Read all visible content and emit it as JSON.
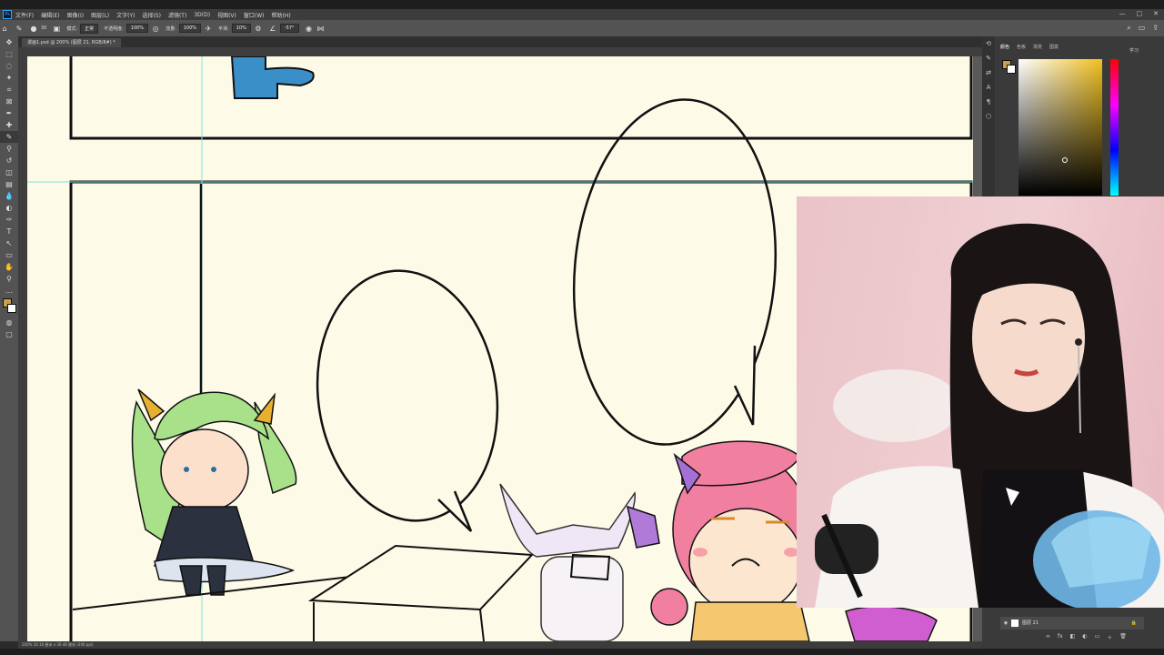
{
  "menu": {
    "app_icon": "Ps",
    "items": [
      "文件(F)",
      "编辑(E)",
      "图像(I)",
      "图层(L)",
      "文字(Y)",
      "选择(S)",
      "滤镜(T)",
      "3D(D)",
      "视图(V)",
      "窗口(W)",
      "帮助(H)"
    ],
    "window_controls": [
      "—",
      "□",
      "✕"
    ]
  },
  "options": {
    "size_value": "30",
    "mode_label": "模式:",
    "mode_value": "正常",
    "opacity_label": "不透明度:",
    "opacity_value": "100%",
    "flow_label": "流量:",
    "flow_value": "100%",
    "smooth_label": "平滑:",
    "smooth_value": "10%",
    "angle_value": "-57°"
  },
  "document": {
    "tab_title": "漫画1.psd @ 200% (图层 21, RGB/8#) *",
    "status_text": "200%    10.16 厘米 x 30.48 厘米 (300 ppi)"
  },
  "right_panel": {
    "tabs": [
      "颜色",
      "色板",
      "渐变",
      "图案"
    ],
    "learn_label": "学习",
    "layer_name": "图层 21",
    "foreground_color": "#c6a04a"
  },
  "canvas": {
    "paper_color": "#fdfbe8",
    "guide_color": "#7fe3e3"
  }
}
